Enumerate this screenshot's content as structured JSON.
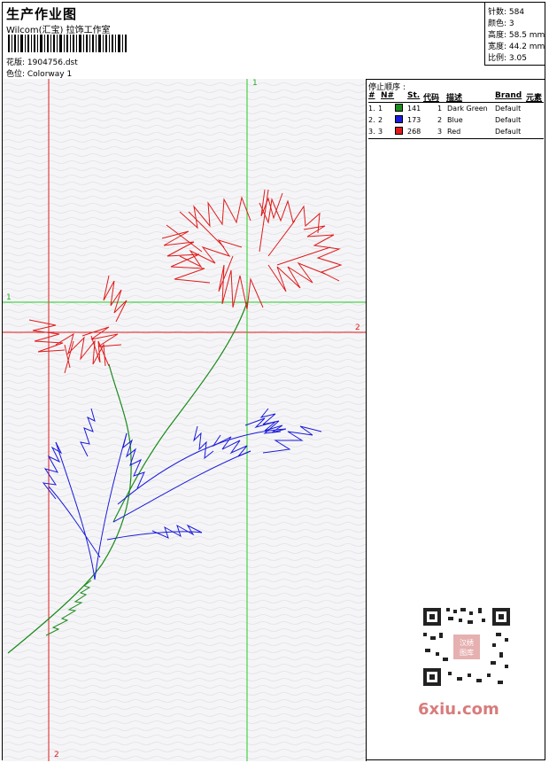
{
  "header": {
    "title": "生产作业图",
    "company": "Wilcom(汇宝) 拉饰工作室",
    "design_label": "花版: 1904756.dst",
    "colorway_label": "色位: Colorway 1"
  },
  "stats": {
    "stitches": "针数: 584",
    "colors": "颜色: 3",
    "height": "高度: 58.5 mm",
    "width": "宽度: 44.2 mm",
    "scale": "比例: 3.05"
  },
  "axis_labels": {
    "top_green": "1",
    "left_green": "1",
    "right_red": "2",
    "bottom_red": "2"
  },
  "sequence": {
    "title": "停止顺序 :",
    "columns": [
      "#",
      "N#",
      "St.",
      "代码",
      "描述",
      "Brand",
      "元素"
    ],
    "rows": [
      {
        "idx": "1.",
        "n": "1",
        "color": "#1a8a1a",
        "st": "141",
        "code": "1",
        "desc": "Dark Green",
        "brand": "Default"
      },
      {
        "idx": "2.",
        "n": "2",
        "color": "#1a1adc",
        "st": "173",
        "code": "2",
        "desc": "Blue",
        "brand": "Default"
      },
      {
        "idx": "3.",
        "n": "3",
        "color": "#e01a1a",
        "st": "268",
        "code": "3",
        "desc": "Red",
        "brand": "Default"
      }
    ]
  },
  "watermark": "6xiu.com",
  "qr_badge": "汉绣图库"
}
